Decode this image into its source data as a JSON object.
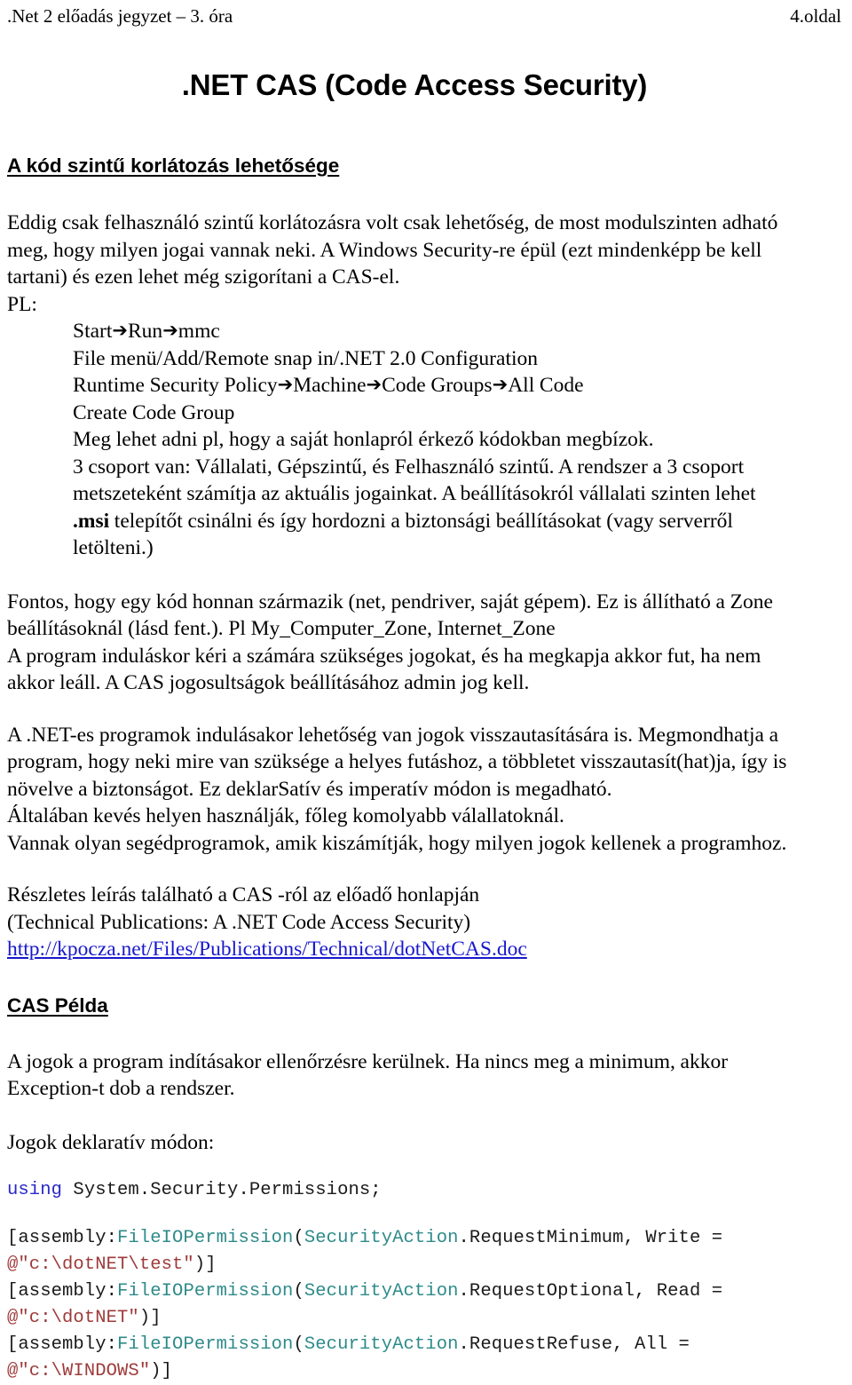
{
  "running_head": {
    "left": ".Net 2 előadás jegyzet – 3. óra",
    "right": "4.oldal"
  },
  "document": {
    "title": ".NET CAS (Code Access Security)"
  },
  "sections": {
    "heading_1": "A kód szintű korlátozás lehetősége",
    "heading_2": "CAS Példa"
  },
  "intro": {
    "line1": "Eddig csak felhasználó szintű korlátozásra volt csak lehetőség, de most modulszinten adható",
    "line2": "meg, hogy milyen jogai vannak neki. A Windows Security-re épül (ezt mindenképp be kell",
    "line3": "tartani) és ezen lehet még szigorítani a CAS-el.",
    "pl_label": "PL:"
  },
  "steps": {
    "arrow_glyph": "➔",
    "line1_a": "Start",
    "line1_b": "Run",
    "line1_c": "mmc",
    "line2": "File menü/Add/Remote snap in/.NET 2.0 Configuration",
    "line3_a": "Runtime Security Policy",
    "line3_b": "Machine",
    "line3_c": "Code Groups",
    "line3_d": "All Code",
    "line4": "Create Code Group",
    "line5": "Meg lehet adni pl, hogy a saját honlapról érkező kódokban megbízok.",
    "line6": "3 csoport van: Vállalati, Gépszintű, és Felhasználó szintű. A rendszer a 3 csoport",
    "line7": "metszeteként számítja az aktuális jogainkat. A beállításokról vállalati szinten lehet",
    "line8_bold": ".msi",
    "line8_rest": " telepítőt csinálni és így hordozni a biztonsági beállításokat (vagy serverről",
    "line9": "letölteni.)"
  },
  "zone_paragraph": {
    "line1": "Fontos, hogy egy kód honnan származik (net, pendriver, saját gépem). Ez is állítható a Zone",
    "line2": "beállításoknál (lásd fent.). Pl My_Computer_Zone, Internet_Zone",
    "line3": "A program induláskor kéri a számára szükséges jogokat, és ha megkapja akkor fut, ha nem",
    "line4": "akkor leáll. A CAS jogosultságok beállításához admin jog kell."
  },
  "refuse_paragraph": {
    "line1": "A .NET-es programok indulásakor lehetőség van jogok visszautasítására is. Megmondhatja a",
    "line2": "program, hogy neki mire van szüksége a helyes futáshoz, a többletet visszautasít(hat)ja, így is",
    "line3": "növelve a biztonságot. Ez deklarSatív és imperatív módon is megadható.",
    "line4": "Általában kevés helyen használják, főleg komolyabb válallatoknál.",
    "line5": "Vannak olyan segédprogramok, amik kiszámítják, hogy milyen jogok kellenek a programhoz."
  },
  "reference": {
    "line1": "Részletes leírás található a CAS -ról az előadő honlapján",
    "line2": "(Technical Publications: A .NET Code Access Security)",
    "link_text": "http://kpocza.net/Files/Publications/Technical/dotNetCAS.doc"
  },
  "example": {
    "line1": "A jogok a program indításakor ellenőrzésre kerülnek. Ha nincs meg a minimum, akkor",
    "line2": "Exception-t dob a rendszer.",
    "line3": "Jogok deklaratív módon:"
  },
  "code": {
    "using_kw": "using",
    "using_ns": " System.Security.Permissions;",
    "l1_pre": "[assembly:",
    "l1_type1": "FileIOPermission",
    "l1_paren": "(",
    "l1_type2": "SecurityAction",
    "l1_rest": ".RequestMinimum, Write =",
    "l2_str": "@\"c:\\dotNET\\test\"",
    "l2_tail": ")]",
    "l3_pre": "[assembly:",
    "l3_type1": "FileIOPermission",
    "l3_paren": "(",
    "l3_type2": "SecurityAction",
    "l3_rest": ".RequestOptional, Read =",
    "l4_str": "@\"c:\\dotNET\"",
    "l4_tail": ")]",
    "l5_pre": "[assembly:",
    "l5_type1": "FileIOPermission",
    "l5_paren": "(",
    "l5_type2": "SecurityAction",
    "l5_rest": ".RequestRefuse, All =",
    "l6_str": "@\"c:\\WINDOWS\"",
    "l6_tail": ")]"
  },
  "colors": {
    "keyword": "#2929c7",
    "type": "#2f8a8a",
    "string": "#9e3a3a",
    "link": "#1818cd",
    "text": "#000000",
    "background": "#ffffff"
  }
}
